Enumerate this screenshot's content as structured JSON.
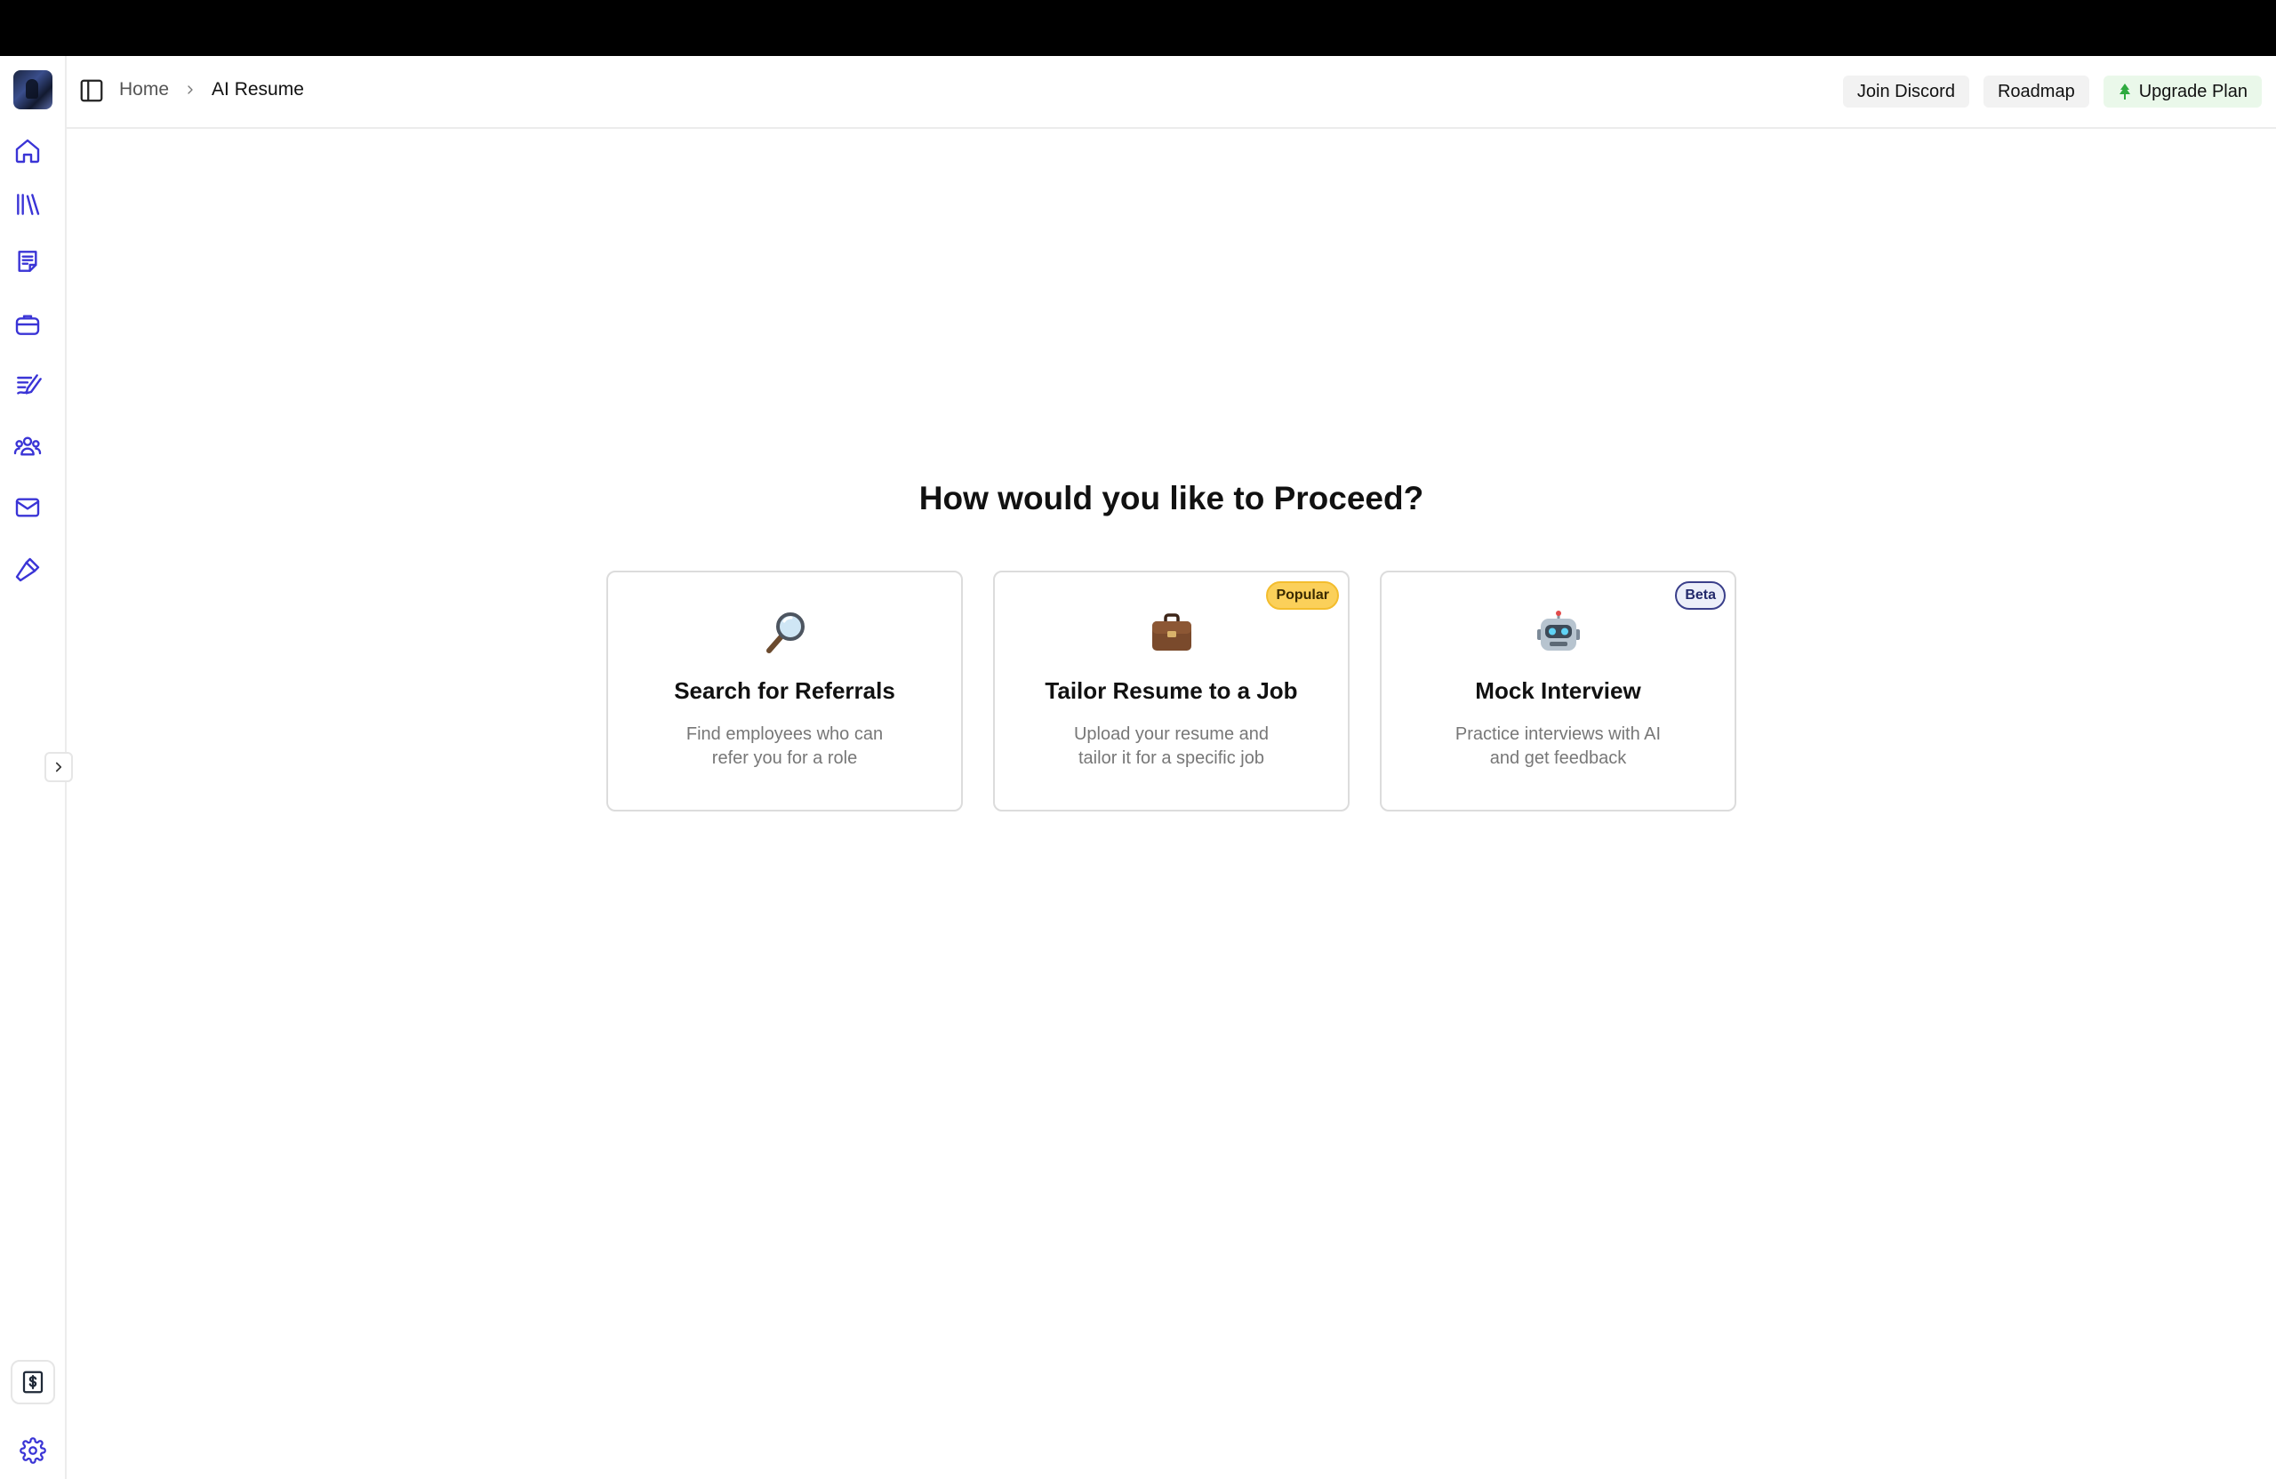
{
  "header": {
    "breadcrumb": {
      "home": "Home",
      "current": "AI Resume"
    },
    "actions": {
      "discord": "Join Discord",
      "roadmap": "Roadmap",
      "upgrade": "Upgrade Plan"
    }
  },
  "sidebar": {
    "items": [
      {
        "icon": "home-icon"
      },
      {
        "icon": "library-icon"
      },
      {
        "icon": "notes-icon"
      },
      {
        "icon": "briefcase-icon"
      },
      {
        "icon": "interview-icon"
      },
      {
        "icon": "people-icon"
      },
      {
        "icon": "mail-icon"
      },
      {
        "icon": "tools-icon"
      }
    ],
    "bottom": [
      {
        "icon": "billing-icon"
      },
      {
        "icon": "gear-icon"
      }
    ]
  },
  "main": {
    "heading": "How would you like to Proceed?",
    "cards": [
      {
        "icon": "magnifier-icon",
        "title": "Search for Referrals",
        "description": "Find employees who can refer you for a role",
        "badge": ""
      },
      {
        "icon": "briefcase-emoji",
        "title": "Tailor Resume to a Job",
        "description": "Upload your resume and tailor it for a specific job",
        "badge": "Popular"
      },
      {
        "icon": "robot-emoji",
        "title": "Mock Interview",
        "description": "Practice interviews with AI and get feedback",
        "badge": "Beta"
      }
    ]
  },
  "colors": {
    "accent": "#3a34d6",
    "popular_badge": "#fbd05a",
    "upgrade_bg": "#eaf8ea"
  }
}
